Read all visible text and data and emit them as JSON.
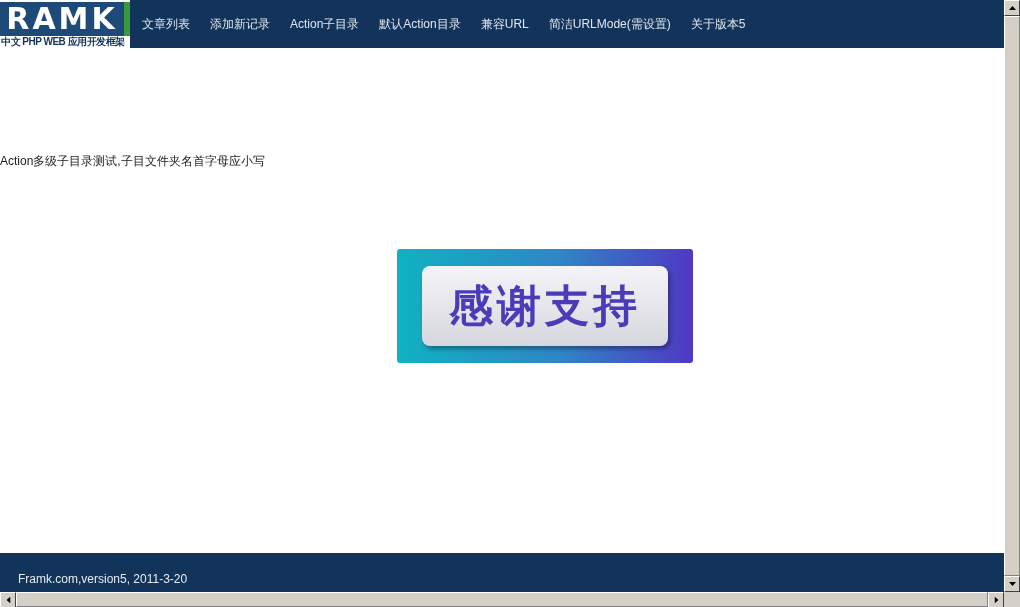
{
  "logo": {
    "mark": "RAMK",
    "subtitle": "中文 PHP WEB 应用开发框架"
  },
  "nav": [
    "文章列表",
    "添加新记录",
    "Action子目录",
    "默认Action目录",
    "兼容URL",
    "简洁URLMode(需设置)",
    "关于版本5"
  ],
  "content": {
    "message": "Action多级子目录测试,子目文件夹名首字母应小写",
    "banner_text": "感谢支持"
  },
  "footer": "Framk.com,version5, 2011-3-20"
}
